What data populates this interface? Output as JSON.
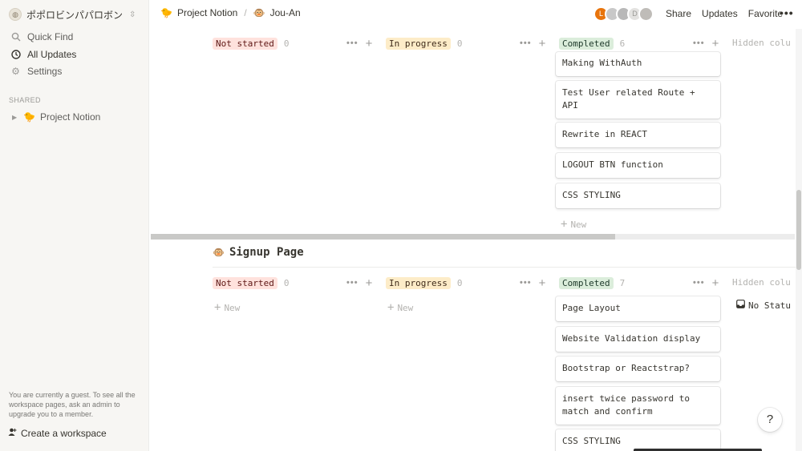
{
  "sidebar": {
    "workspace_name": "ポポロビンパパロボン",
    "nav": [
      {
        "label": "Quick Find",
        "icon": "search-icon"
      },
      {
        "label": "All Updates",
        "icon": "clock-icon",
        "active": true
      },
      {
        "label": "Settings",
        "icon": "gear-icon"
      }
    ],
    "shared_label": "SHARED",
    "pages": [
      {
        "label": "Project Notion",
        "emoji": "🐤"
      }
    ],
    "guest_note": "You are currently a guest. To see all the workspace pages, ask an admin to upgrade you to a member.",
    "create_workspace": "Create a workspace"
  },
  "topbar": {
    "breadcrumbs": [
      {
        "label": "Project Notion",
        "emoji": "🐤"
      },
      {
        "label": "Jou-An",
        "emoji": "🐵"
      }
    ],
    "separator": "/",
    "avatars": [
      {
        "letter": "L",
        "color": "#e8740c"
      },
      {
        "letter": "",
        "color": "#c8c8c8"
      },
      {
        "letter": "",
        "color": "#b8b8b8"
      },
      {
        "letter": "D",
        "color": "#e3e2e0"
      },
      {
        "letter": "",
        "color": "#bfbcb8"
      }
    ],
    "share": "Share",
    "updates": "Updates",
    "favorite": "Favorite",
    "more": "•••"
  },
  "board1": {
    "columns": [
      {
        "label": "Not started",
        "count": "0",
        "color": "red"
      },
      {
        "label": "In progress",
        "count": "0",
        "color": "yellow"
      },
      {
        "label": "Completed",
        "count": "6",
        "color": "green"
      }
    ],
    "hidden_label": "Hidden colu",
    "completed_cards": [
      "Making WithAuth",
      "Test User related Route + API",
      "Rewrite in REACT",
      "LOGOUT BTN function",
      "CSS STYLING"
    ],
    "new_label": "New"
  },
  "board2": {
    "title": "Signup Page",
    "title_emoji": "🐵",
    "columns": [
      {
        "label": "Not started",
        "count": "0",
        "color": "red"
      },
      {
        "label": "In progress",
        "count": "0",
        "color": "yellow"
      },
      {
        "label": "Completed",
        "count": "7",
        "color": "green"
      }
    ],
    "hidden_label": "Hidden colu",
    "no_status": "No Statu",
    "completed_cards": [
      "Page Layout",
      "Website Validation display",
      "Bootstrap or Reactstrap?",
      "insert twice password to match and confirm",
      "CSS STYLING"
    ],
    "new_label": "New"
  },
  "help": "?",
  "colors": {
    "accent_red": "#ffe2dd",
    "accent_yellow": "#fdecc8",
    "accent_green": "#dbeddb",
    "sidebar_bg": "#f7f6f3"
  }
}
